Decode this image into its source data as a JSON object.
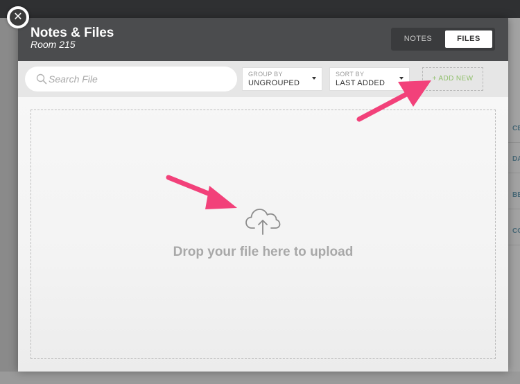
{
  "background_app": {
    "right_cells": [
      "CE",
      "DA",
      "BE",
      "CO"
    ]
  },
  "modal": {
    "title": "Notes & Files",
    "subtitle": "Room 215",
    "tabs": [
      {
        "label": "NOTES",
        "active": false
      },
      {
        "label": "FILES",
        "active": true
      }
    ]
  },
  "toolbar": {
    "search": {
      "placeholder": "Search File",
      "value": ""
    },
    "group_by": {
      "caption": "GROUP BY",
      "value": "UNGROUPED"
    },
    "sort_by": {
      "caption": "SORT BY",
      "value": "LAST ADDED"
    },
    "add_new_label": "+ ADD NEW"
  },
  "dropzone": {
    "text": "Drop your file here to upload",
    "icon": "cloud-upload-icon"
  },
  "icons": {
    "close": "close-icon",
    "search": "search-icon",
    "caret": "caret-down-icon"
  },
  "colors": {
    "header_bg": "#4b4c4e",
    "add_new_text": "#8fbf6a",
    "annotation_arrow": "#f2417a"
  }
}
